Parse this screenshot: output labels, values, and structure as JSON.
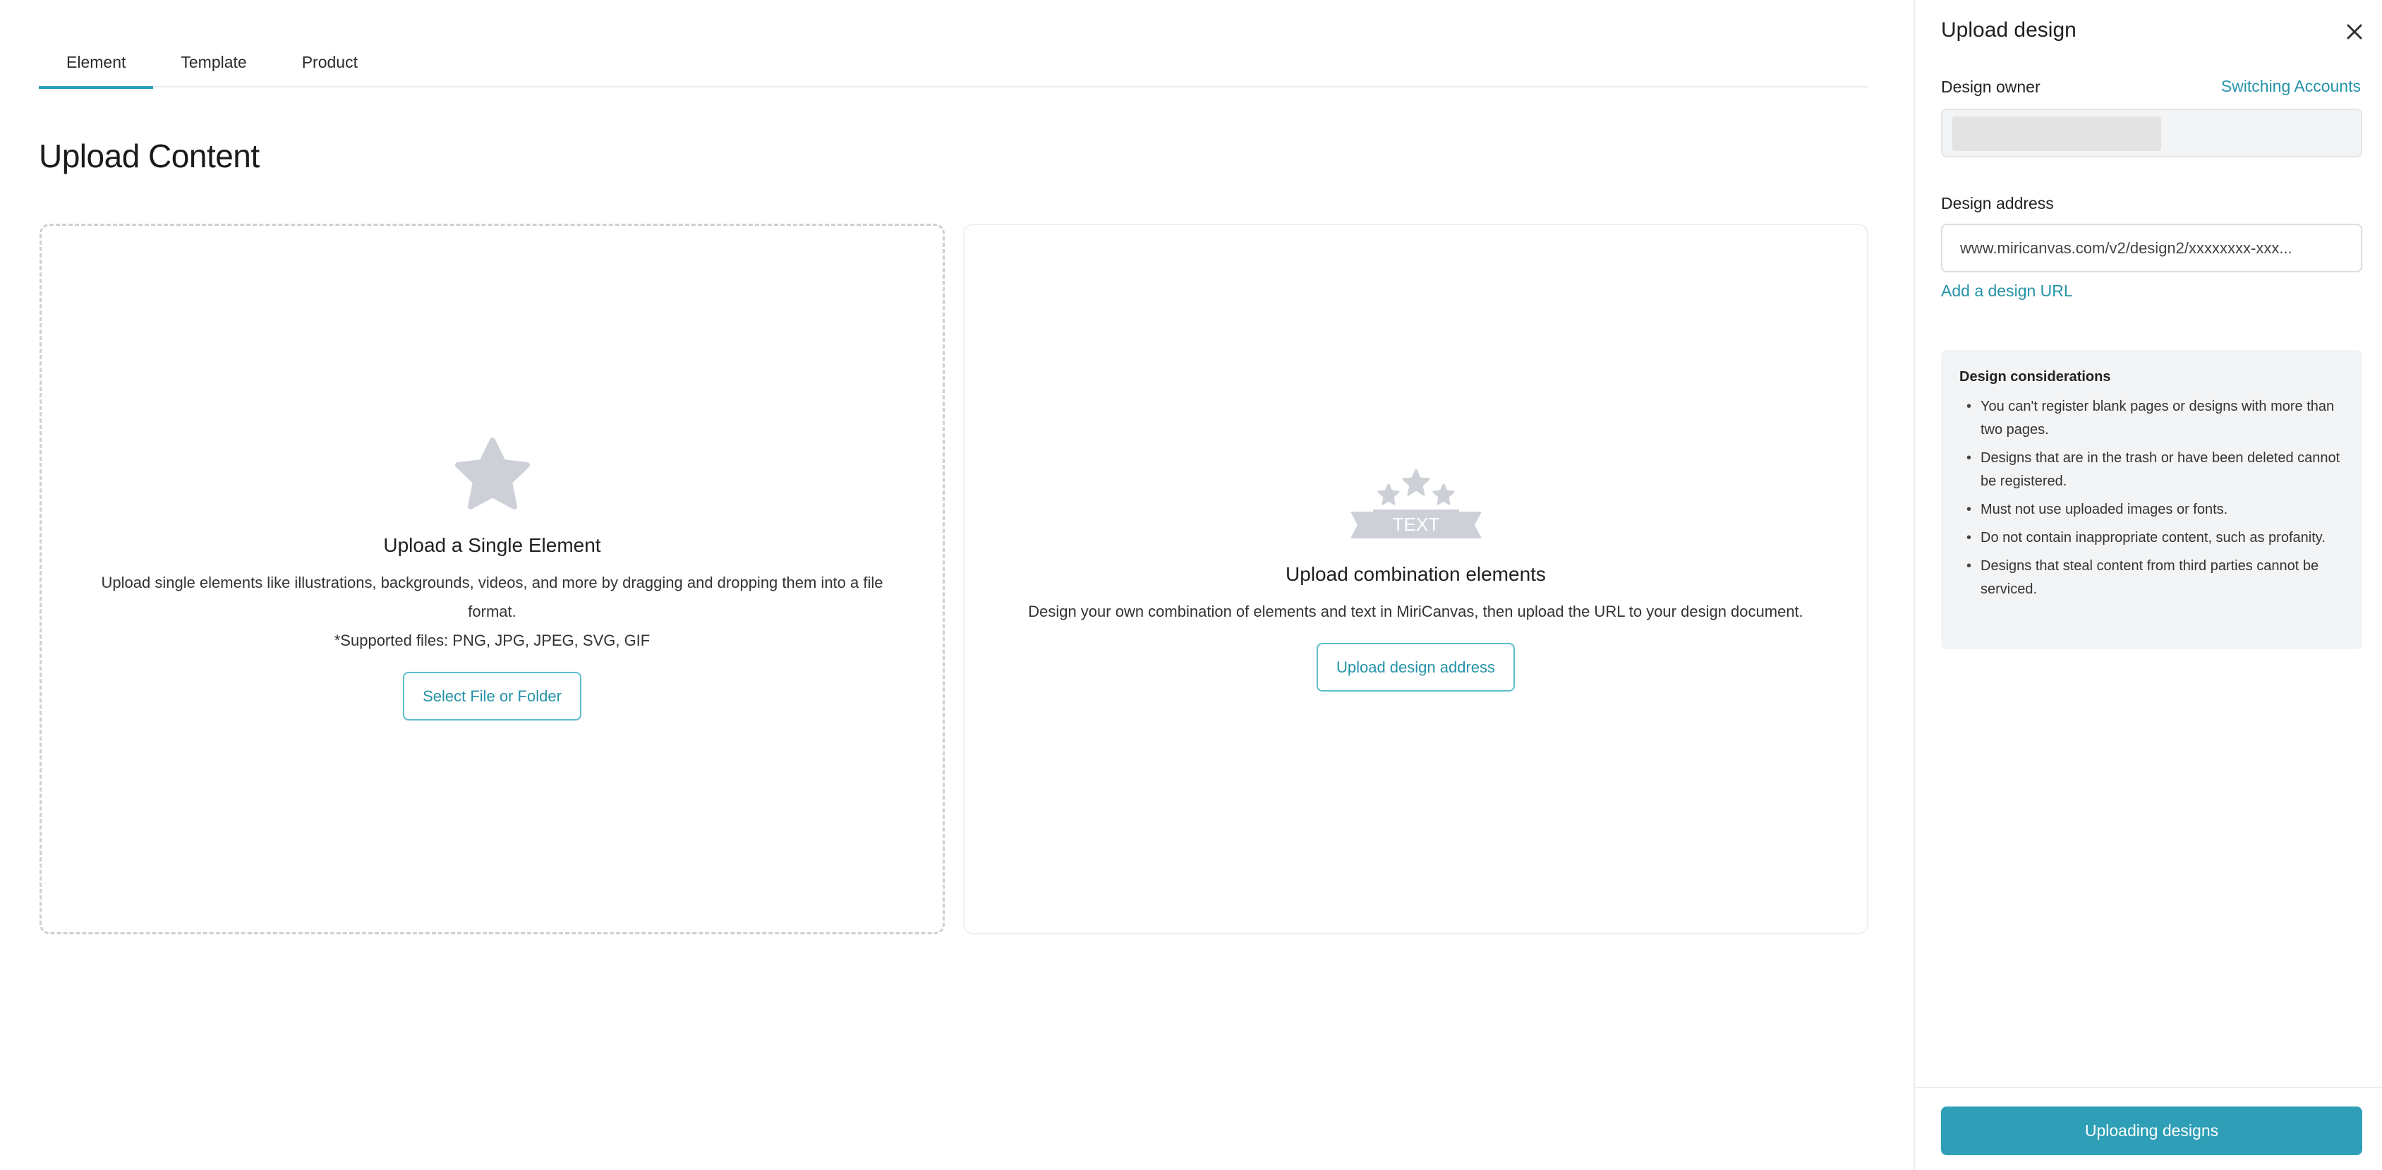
{
  "tabs": [
    {
      "label": "Element",
      "active": true
    },
    {
      "label": "Template",
      "active": false
    },
    {
      "label": "Product",
      "active": false
    }
  ],
  "page_title": "Upload Content",
  "single_card": {
    "icon": "star-icon",
    "title": "Upload a Single Element",
    "description": "Upload single elements like illustrations, backgrounds, videos, and more by dragging and dropping them into a file format.",
    "supported": "*Supported files: PNG, JPG, JPEG, SVG, GIF",
    "button_label": "Select File or Folder"
  },
  "combo_card": {
    "icon": "text-badge-icon",
    "icon_text": "TEXT",
    "title": "Upload combination elements",
    "description": "Design your own combination of elements and text in MiriCanvas, then upload the URL to your design document.",
    "button_label": "Upload design address"
  },
  "panel": {
    "title": "Upload design",
    "owner_label": "Design owner",
    "switch_accounts": "Switching Accounts",
    "address_label": "Design address",
    "address_value": "www.miricanvas.com/v2/design2/xxxxxxxx-xxx...",
    "add_url": "Add a design URL",
    "considerations_title": "Design considerations",
    "considerations": [
      "You can't register blank pages or designs with more than two pages.",
      "Designs that are in the trash or have been deleted cannot be registered.",
      "Must not use uploaded images or fonts.",
      "Do not contain inappropriate content, such as profanity.",
      "Designs that steal content from third parties cannot be serviced."
    ],
    "submit_label": "Uploading designs"
  },
  "colors": {
    "accent": "#2a9fb5",
    "primary_button": "#2e9fb6",
    "icon_gray": "#cdd1d7"
  }
}
